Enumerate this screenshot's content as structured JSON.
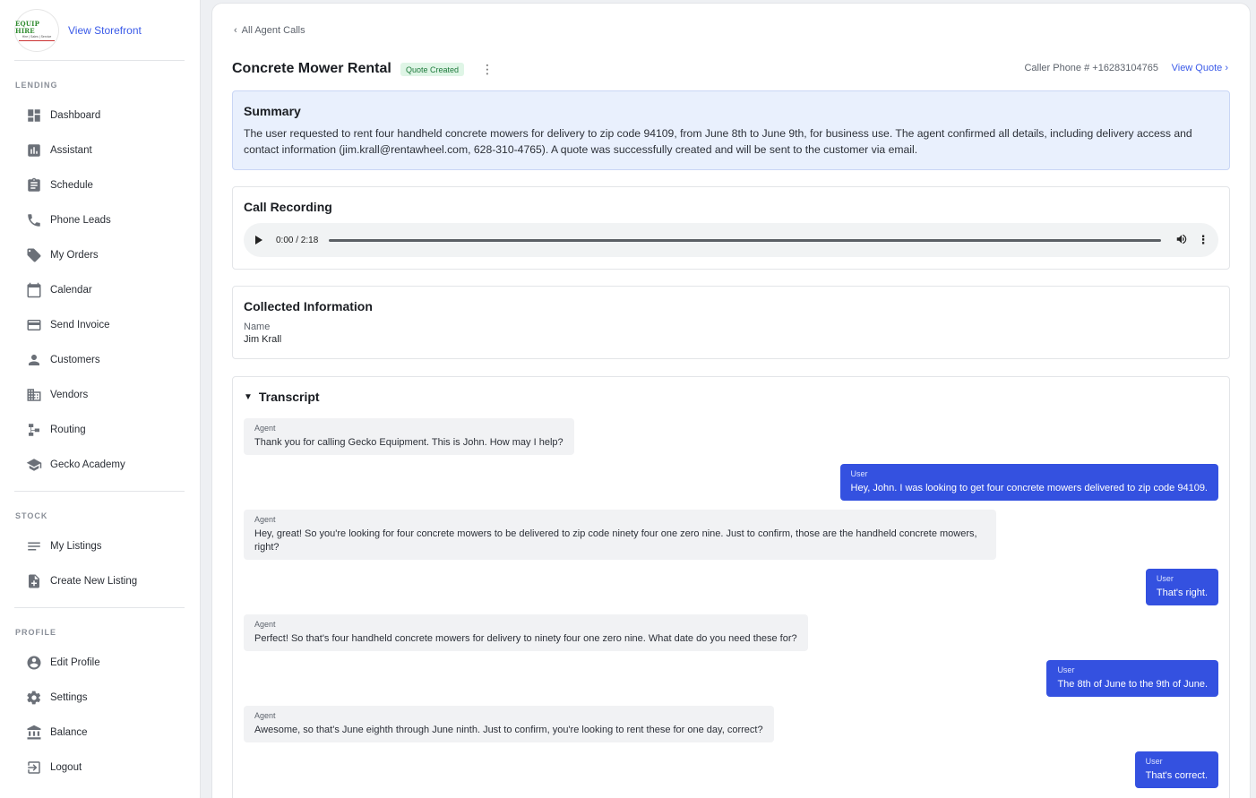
{
  "brand": {
    "logo_line1": "EQUIP HIRE",
    "logo_line2": "Hire | Sales | Service",
    "view_storefront": "View Storefront"
  },
  "sidebar": {
    "sections": [
      {
        "title": "LENDING"
      },
      {
        "title": "STOCK"
      },
      {
        "title": "PROFILE"
      }
    ],
    "lending": [
      {
        "label": "Dashboard",
        "icon": "dashboard-icon"
      },
      {
        "label": "Assistant",
        "icon": "bar-chart-icon"
      },
      {
        "label": "Schedule",
        "icon": "clipboard-icon"
      },
      {
        "label": "Phone Leads",
        "icon": "phone-icon"
      },
      {
        "label": "My Orders",
        "icon": "tag-icon"
      },
      {
        "label": "Calendar",
        "icon": "calendar-icon"
      },
      {
        "label": "Send Invoice",
        "icon": "credit-card-icon"
      },
      {
        "label": "Customers",
        "icon": "person-icon"
      },
      {
        "label": "Vendors",
        "icon": "building-icon"
      },
      {
        "label": "Routing",
        "icon": "routing-icon"
      },
      {
        "label": "Gecko Academy",
        "icon": "graduation-cap-icon"
      }
    ],
    "stock": [
      {
        "label": "My Listings",
        "icon": "list-icon"
      },
      {
        "label": "Create New Listing",
        "icon": "add-document-icon"
      }
    ],
    "profile": [
      {
        "label": "Edit Profile",
        "icon": "account-circle-icon"
      },
      {
        "label": "Settings",
        "icon": "gear-icon"
      },
      {
        "label": "Balance",
        "icon": "bank-icon"
      },
      {
        "label": "Logout",
        "icon": "logout-icon"
      }
    ]
  },
  "header": {
    "back_label": "All Agent Calls",
    "title": "Concrete Mower Rental",
    "status": "Quote Created",
    "caller_phone": "Caller Phone # +16283104765",
    "view_quote": "View Quote ›"
  },
  "summary": {
    "heading": "Summary",
    "text": "The user requested to rent four handheld concrete mowers for delivery to zip code 94109, from June 8th to June 9th, for business use. The agent confirmed all details, including delivery access and contact information (jim.krall@rentawheel.com, 628-310-4765). A quote was successfully created and will be sent to the customer via email."
  },
  "recording": {
    "heading": "Call Recording",
    "time": "0:00 / 2:18",
    "progress": 0
  },
  "collected": {
    "heading": "Collected Information",
    "name_label": "Name",
    "name_value": "Jim Krall"
  },
  "transcript": {
    "heading": "Transcript",
    "messages": [
      {
        "role": "Agent",
        "text": "Thank you for calling Gecko Equipment. This is John. How may I help?"
      },
      {
        "role": "User",
        "text": "Hey, John. I was looking to get four concrete mowers delivered to zip code 94109."
      },
      {
        "role": "Agent",
        "text": "Hey, great! So you're looking for four concrete mowers to be delivered to zip code ninety four one zero nine. Just to confirm, those are the handheld concrete mowers, right?"
      },
      {
        "role": "User",
        "text": "That's right."
      },
      {
        "role": "Agent",
        "text": "Perfect! So that's four handheld concrete mowers for delivery to ninety four one zero nine. What date do you need these for?"
      },
      {
        "role": "User",
        "text": "The 8th of June to the 9th of June."
      },
      {
        "role": "Agent",
        "text": "Awesome, so that's June eighth through June ninth. Just to confirm, you're looking to rent these for one day, correct?"
      },
      {
        "role": "User",
        "text": "That's correct."
      }
    ]
  },
  "colors": {
    "accent": "#3451e0",
    "link": "#3a5ae8",
    "summary_bg": "#e9f0fd",
    "badge_bg": "#dff5e6",
    "badge_text": "#1e7a3c"
  }
}
